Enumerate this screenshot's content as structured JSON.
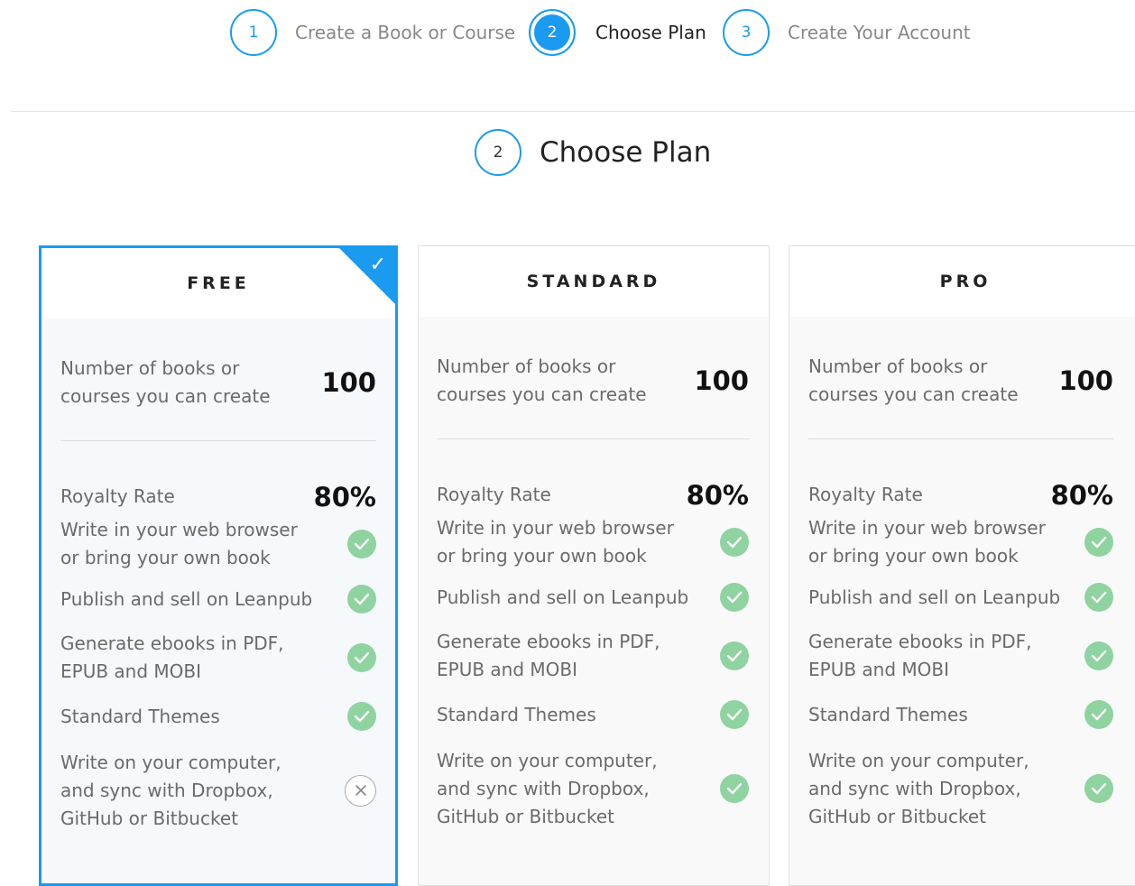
{
  "stepper": {
    "steps": [
      {
        "number": "1",
        "label": "Create a Book or Course"
      },
      {
        "number": "2",
        "label": "Choose Plan"
      },
      {
        "number": "3",
        "label": "Create Your Account"
      }
    ]
  },
  "section": {
    "number": "2",
    "title": "Choose Plan"
  },
  "accent_color": "#1a9bf0",
  "check_color": "#8fd3a0",
  "plans": [
    {
      "name": "FREE",
      "selected": true,
      "books_label": "Number of books or courses you can create",
      "books_value": "100",
      "royalty_label": "Royalty Rate",
      "royalty_value": "80%",
      "features": [
        {
          "label": "Write in your web browser or bring your own book",
          "included": true
        },
        {
          "label": "Publish and sell on Leanpub",
          "included": true
        },
        {
          "label": "Generate ebooks in PDF, EPUB and MOBI",
          "included": true
        },
        {
          "label": "Standard Themes",
          "included": true
        },
        {
          "label": "Write on your computer, and sync with Dropbox, GitHub or Bitbucket",
          "included": false
        }
      ]
    },
    {
      "name": "STANDARD",
      "selected": false,
      "books_label": "Number of books or courses you can create",
      "books_value": "100",
      "royalty_label": "Royalty Rate",
      "royalty_value": "80%",
      "features": [
        {
          "label": "Write in your web browser or bring your own book",
          "included": true
        },
        {
          "label": "Publish and sell on Leanpub",
          "included": true
        },
        {
          "label": "Generate ebooks in PDF, EPUB and MOBI",
          "included": true
        },
        {
          "label": "Standard Themes",
          "included": true
        },
        {
          "label": "Write on your computer, and sync with Dropbox, GitHub or Bitbucket",
          "included": true
        }
      ]
    },
    {
      "name": "PRO",
      "selected": false,
      "books_label": "Number of books or courses you can create",
      "books_value": "100",
      "royalty_label": "Royalty Rate",
      "royalty_value": "80%",
      "features": [
        {
          "label": "Write in your web browser or bring your own book",
          "included": true
        },
        {
          "label": "Publish and sell on Leanpub",
          "included": true
        },
        {
          "label": "Generate ebooks in PDF, EPUB and MOBI",
          "included": true
        },
        {
          "label": "Standard Themes",
          "included": true
        },
        {
          "label": "Write on your computer, and sync with Dropbox, GitHub or Bitbucket",
          "included": true
        }
      ]
    }
  ]
}
